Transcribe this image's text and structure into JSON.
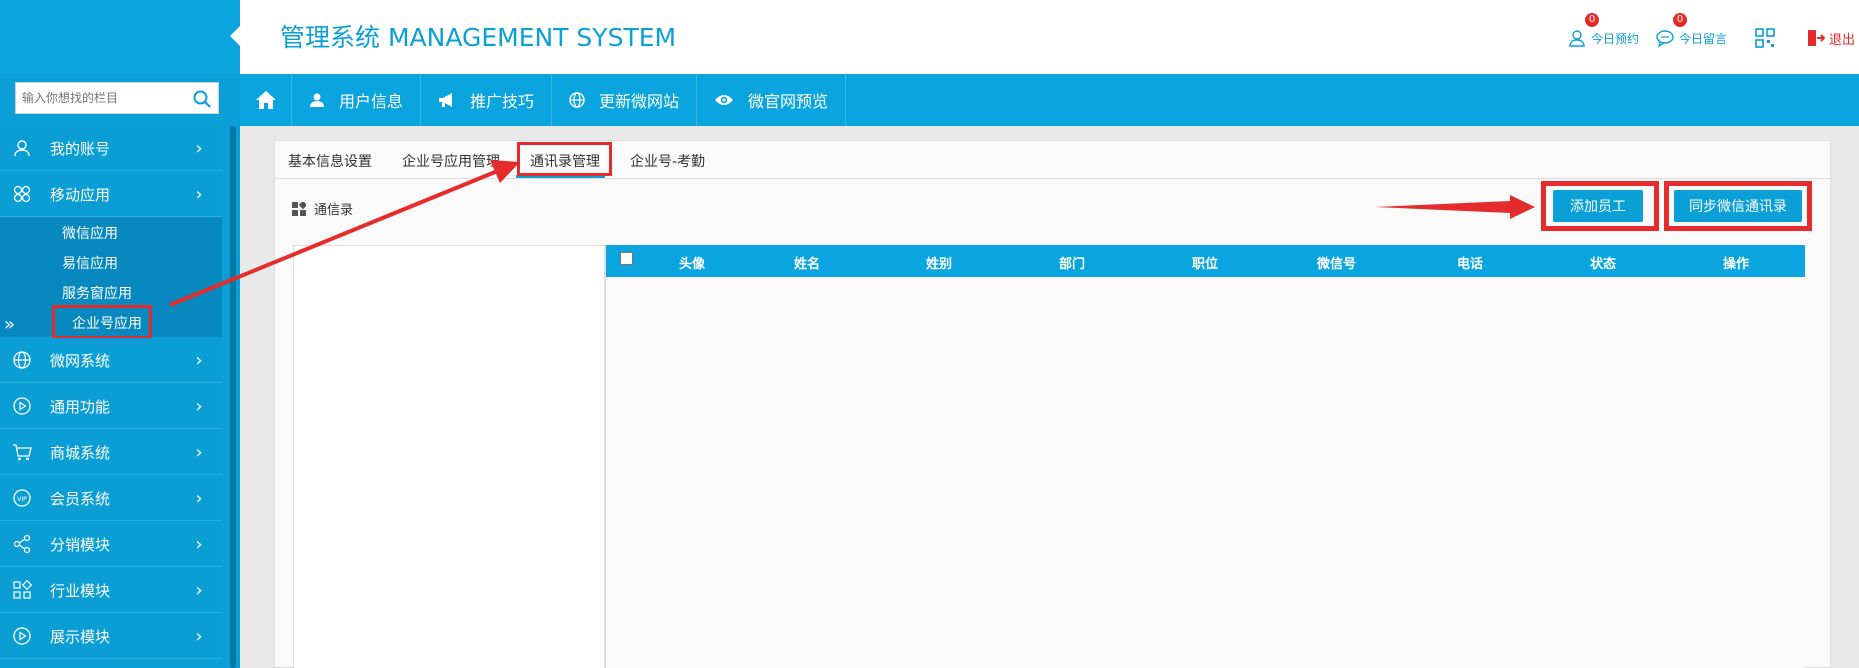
{
  "header": {
    "title": "管理系统 MANAGEMENT SYSTEM",
    "tools": [
      {
        "label": "今日预约",
        "badge": "0",
        "icon": "user-icon"
      },
      {
        "label": "今日留言",
        "badge": "0",
        "icon": "comment-icon"
      },
      {
        "label": "",
        "icon": "qrcode-icon"
      }
    ],
    "logout_label": "退出",
    "colors": {
      "brand": "#0a9fd6",
      "alert": "#e52b2b"
    }
  },
  "sidebar": {
    "search_placeholder": "输入你想找的栏目",
    "items": [
      {
        "label": "我的账号",
        "icon": "user-icon"
      },
      {
        "label": "移动应用",
        "icon": "apps-icon"
      },
      {
        "label": "微网系统",
        "icon": "globe-icon"
      },
      {
        "label": "通用功能",
        "icon": "play-circle-icon"
      },
      {
        "label": "商城系统",
        "icon": "cart-icon"
      },
      {
        "label": "会员系统",
        "icon": "vip-icon"
      },
      {
        "label": "分销模块",
        "icon": "share-icon"
      },
      {
        "label": "行业模块",
        "icon": "grid-icon"
      },
      {
        "label": "展示模块",
        "icon": "play-circle-icon"
      }
    ],
    "sub_items": [
      {
        "label": "微信应用"
      },
      {
        "label": "易信应用"
      },
      {
        "label": "服务窗应用"
      },
      {
        "label": "企业号应用"
      }
    ]
  },
  "topnav": {
    "items": [
      {
        "label": "用户信息",
        "icon": "person-icon"
      },
      {
        "label": "推广技巧",
        "icon": "megaphone-icon"
      },
      {
        "label": "更新微网站",
        "icon": "globe-icon"
      },
      {
        "label": "微官网预览",
        "icon": "eye-icon"
      }
    ]
  },
  "tabs": [
    {
      "label": "基本信息设置"
    },
    {
      "label": "企业号应用管理"
    },
    {
      "label": "通讯录管理"
    },
    {
      "label": "企业号-考勤"
    }
  ],
  "main": {
    "section_title": "通信录",
    "add_button": "添加员工",
    "sync_button": "同步微信通讯录",
    "columns": [
      "头像",
      "姓名",
      "姓别",
      "部门",
      "职位",
      "微信号",
      "电话",
      "状态",
      "操作"
    ]
  }
}
